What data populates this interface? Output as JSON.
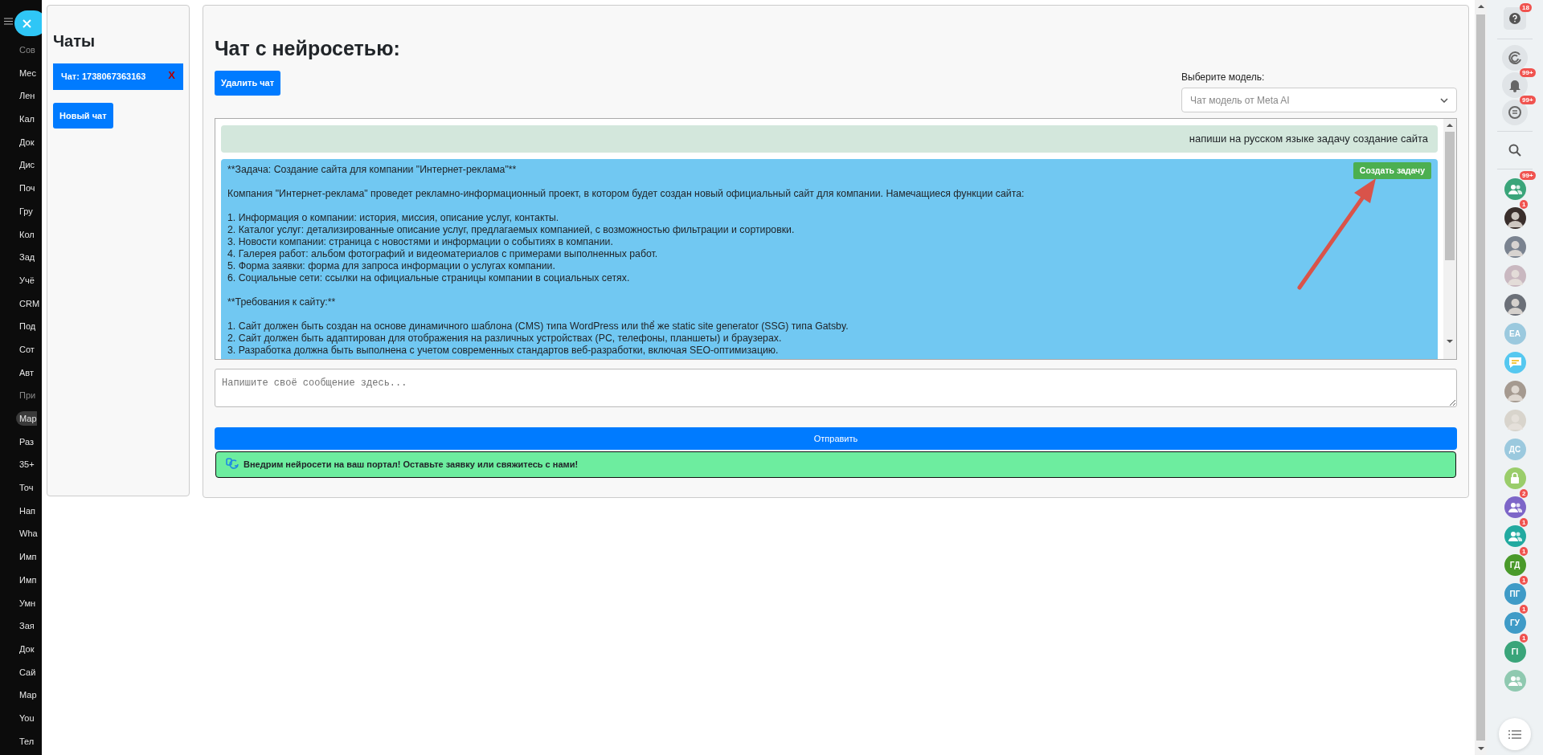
{
  "portal_menu": {
    "items": [
      {
        "label": "Сов",
        "kind": "header",
        "selected": false
      },
      {
        "label": "Мес",
        "kind": "item",
        "selected": false
      },
      {
        "label": "Лен",
        "kind": "item",
        "selected": false
      },
      {
        "label": "Кал",
        "kind": "item",
        "selected": false
      },
      {
        "label": "Док",
        "kind": "item",
        "selected": false
      },
      {
        "label": "Дис",
        "kind": "item",
        "selected": false
      },
      {
        "label": "Поч",
        "kind": "item",
        "selected": false
      },
      {
        "label": "Гру",
        "kind": "item",
        "selected": false
      },
      {
        "label": "Кол",
        "kind": "item",
        "selected": false
      },
      {
        "label": "Зад",
        "kind": "item",
        "selected": false
      },
      {
        "label": "Учё",
        "kind": "item",
        "selected": false
      },
      {
        "label": "CRM",
        "kind": "item",
        "selected": false
      },
      {
        "label": "Под",
        "kind": "item",
        "selected": false
      },
      {
        "label": "Сот",
        "kind": "item",
        "selected": false
      },
      {
        "label": "Авт",
        "kind": "item",
        "selected": false
      },
      {
        "label": "При",
        "kind": "header",
        "selected": false
      },
      {
        "label": "Мар",
        "kind": "item",
        "selected": true
      },
      {
        "label": "Раз",
        "kind": "item",
        "selected": false
      },
      {
        "label": "35+",
        "kind": "item",
        "selected": false
      },
      {
        "label": "Точ",
        "kind": "item",
        "selected": false
      },
      {
        "label": "Нап",
        "kind": "item",
        "selected": false
      },
      {
        "label": "Wha",
        "kind": "item",
        "selected": false
      },
      {
        "label": "Имп",
        "kind": "item",
        "selected": false
      },
      {
        "label": "Имп",
        "kind": "item",
        "selected": false
      },
      {
        "label": "Умн",
        "kind": "item",
        "selected": false
      },
      {
        "label": "Зая",
        "kind": "item",
        "selected": false
      },
      {
        "label": "Док",
        "kind": "item",
        "selected": false
      },
      {
        "label": "Сай",
        "kind": "item",
        "selected": false
      },
      {
        "label": "Мар",
        "kind": "item",
        "selected": false
      },
      {
        "label": "You",
        "kind": "item",
        "selected": false
      },
      {
        "label": "Тел",
        "kind": "item",
        "selected": false
      }
    ]
  },
  "chats_panel": {
    "title": "Чаты",
    "chats": [
      {
        "label": "Чат: 1738067363163",
        "delete": "X",
        "selected": true
      }
    ],
    "new_chat_button": "Новый чат"
  },
  "main_panel": {
    "title": "Чат с нейросетью:",
    "delete_button": "Удалить чат",
    "model_select": {
      "label": "Выберите модель:",
      "value": "Чат модель от Meta AI"
    },
    "messages": [
      {
        "kind": "user",
        "text": "напиши на русском языке задачу создание сайта"
      },
      {
        "kind": "assistant",
        "action": "Создать задачу",
        "text": "**Задача: Создание сайта для компании \"Интернет-реклама\"**\n\nКомпания \"Интернет-реклама\" проведет рекламно-информационный проект, в котором будет создан новый официальный сайт для компании. Намечащиеся функции сайта:\n\n1. Информация о компании: история, миссия, описание услуг, контакты.\n2. Каталог услуг: детализированные описание услуг, предлагаемых компанией, с возможностью фильтрации и сортировки.\n3. Новости компании: страница с новостями и информации о событиях в компании.\n4. Галерея работ: альбом фотографий и видеоматериалов с примерами выполненных работ.\n5. Форма заявки: форма для запроса информации о услугах компании.\n6. Социальные сети: ссылки на официальные страницы компании в социальных сетях.\n\n**Требования к сайту:**\n\n1. Сайт должен быть создан на основе динамичного шаблона (CMS) типа WordPress или thể же static site generator (SSG) типа Gatsby.\n2. Сайт должен быть адаптирован для отображения на различных устройствах (PC, телефоны, планшеты) и браузерах.\n3. Разработка должна быть выполнена с учетом современных стандартов веб-разработки, включая SEO-оптимизацию."
      }
    ],
    "message_input": {
      "placeholder": "Напишите своё сообщение здесь..."
    },
    "send_button": "Отправить",
    "banner": "Внедрим нейросети на ваш портал! Оставьте заявку или свяжитесь с нами!"
  },
  "right_bar": {
    "tools": [
      {
        "kind": "help",
        "badge": "18"
      },
      {
        "kind": "divider"
      },
      {
        "kind": "spiral"
      },
      {
        "kind": "bell",
        "badge": "99+"
      },
      {
        "kind": "chat",
        "badge": "99+"
      },
      {
        "kind": "divider"
      },
      {
        "kind": "search"
      },
      {
        "kind": "divider"
      }
    ],
    "contacts": [
      {
        "kind": "group",
        "color": "#3aa57a",
        "badge": "99+"
      },
      {
        "kind": "photo",
        "color": "#3a2f2c",
        "badge": "1"
      },
      {
        "kind": "photo",
        "color": "#7a8390"
      },
      {
        "kind": "photo",
        "color": "#c9b8c0"
      },
      {
        "kind": "photo",
        "color": "#6b7078"
      },
      {
        "kind": "initials",
        "initials": "ЕА",
        "color": "#9bc9de"
      },
      {
        "kind": "message",
        "color": "#55c8f0"
      },
      {
        "kind": "photo",
        "color": "#a59a90"
      },
      {
        "kind": "photo",
        "color": "#d8d4cc"
      },
      {
        "kind": "initials",
        "initials": "ДС",
        "color": "#9bc9de"
      },
      {
        "kind": "lock",
        "color": "#9acd6a"
      },
      {
        "kind": "group",
        "color": "#7d66c8",
        "badge": "2"
      },
      {
        "kind": "group",
        "color": "#22aaa0",
        "badge": "1"
      },
      {
        "kind": "initials",
        "initials": "ГД",
        "color": "#4a9a2a",
        "badge": "1"
      },
      {
        "kind": "initials",
        "initials": "ПГ",
        "color": "#3f9bc7",
        "badge": "1"
      },
      {
        "kind": "initials",
        "initials": "ГУ",
        "color": "#3f9bc7",
        "badge": "1"
      },
      {
        "kind": "initials",
        "initials": "ГІ",
        "color": "#3aa57a",
        "badge": "1"
      },
      {
        "kind": "group",
        "color": "#8fc9b0"
      }
    ]
  }
}
